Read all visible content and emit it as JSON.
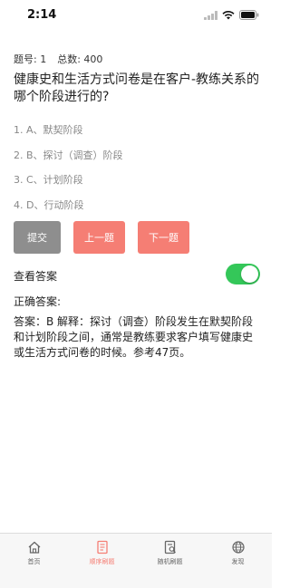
{
  "status_bar": {
    "time": "2:14"
  },
  "question": {
    "number_label": "题号: 1",
    "total_label": "总数: 400",
    "text": "健康史和生活方式问卷是在客户-教练关系的哪个阶段进行的?"
  },
  "options": [
    {
      "label": "1. A、默契阶段"
    },
    {
      "label": "2. B、探讨（调查）阶段"
    },
    {
      "label": "3. C、计划阶段"
    },
    {
      "label": "4. D、行动阶段"
    }
  ],
  "buttons": {
    "submit": "提交",
    "prev": "上一题",
    "next": "下一题"
  },
  "show_answer": {
    "label": "查看答案",
    "enabled": true
  },
  "answer": {
    "heading": "正确答案:",
    "text": "答案：B 解释：探讨（调查）阶段发生在默契阶段和计划阶段之间，通常是教练要求客户填写健康史或生活方式问卷的时候。参考47页。"
  },
  "tabbar": {
    "active_index": 1,
    "items": [
      {
        "label": "首页",
        "icon": "home-icon"
      },
      {
        "label": "顺序刷题",
        "icon": "sequential-practice-icon"
      },
      {
        "label": "随机刷题",
        "icon": "random-practice-icon"
      },
      {
        "label": "发现",
        "icon": "globe-icon"
      }
    ]
  },
  "colors": {
    "accent": "#f57e74",
    "submit": "#8e8e8e",
    "toggle_on": "#34c759"
  }
}
